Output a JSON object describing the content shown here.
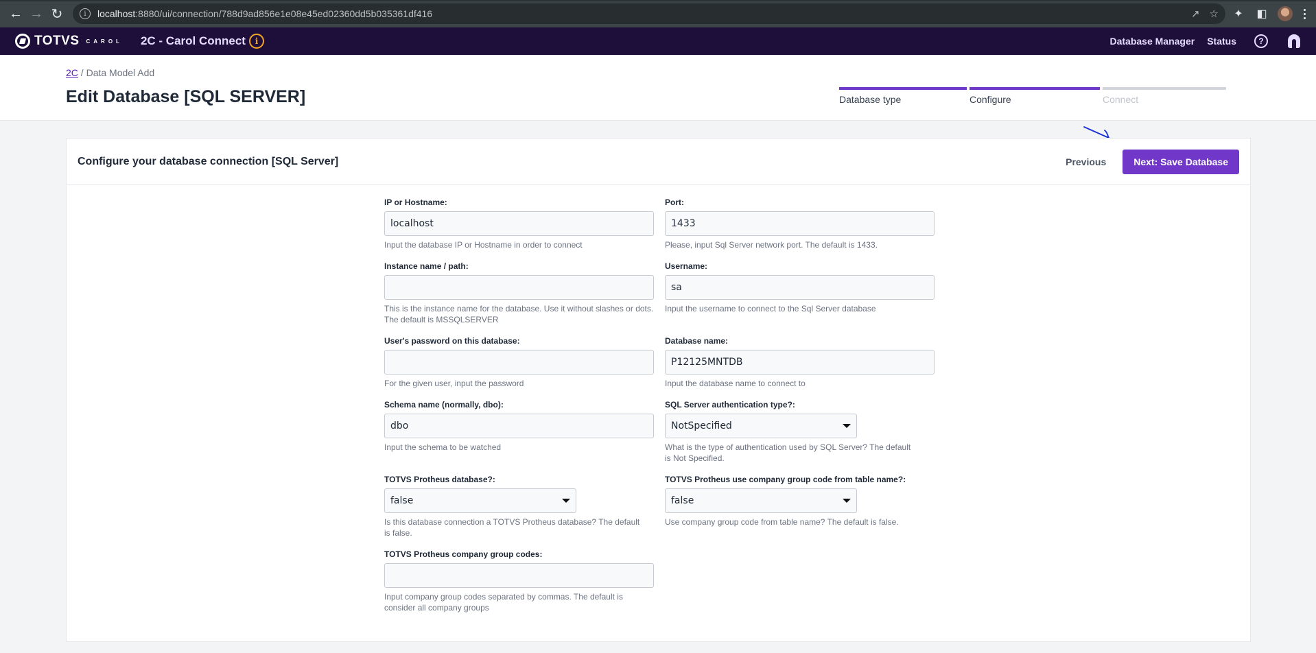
{
  "browser": {
    "url_host": "localhost",
    "url_rest": ":8880/ui/connection/788d9ad856e1e08e45ed02360dd5b035361df416"
  },
  "app": {
    "logo_text": "TOTVS",
    "logo_sub": "CAROL",
    "title": "2C - Carol Connect",
    "info_glyph": "i",
    "nav": [
      {
        "label": "Database Manager"
      },
      {
        "label": "Status"
      }
    ],
    "help_glyph": "?"
  },
  "page": {
    "breadcrumb_link": "2C",
    "breadcrumb_sep": " / ",
    "breadcrumb_current": "Data Model Add",
    "title": "Edit Database [SQL SERVER]",
    "steps": [
      {
        "label": "Database type",
        "state": "done"
      },
      {
        "label": "Configure",
        "state": "done"
      },
      {
        "label": "Connect",
        "state": "pending"
      }
    ]
  },
  "card": {
    "title": "Configure your database connection [SQL Server]",
    "previous_label": "Previous",
    "next_label": "Next: Save Database"
  },
  "form": {
    "host": {
      "label": "IP or Hostname:",
      "value": "localhost",
      "help": "Input the database IP or Hostname in order to connect"
    },
    "port": {
      "label": "Port:",
      "value": "1433",
      "help": "Please, input Sql Server network port. The default is 1433."
    },
    "instance": {
      "label": "Instance name / path:",
      "value": "",
      "help": "This is the instance name for the database. Use it without slashes or dots. The default is MSSQLSERVER"
    },
    "username": {
      "label": "Username:",
      "value": "sa",
      "help": "Input the username to connect to the Sql Server database"
    },
    "password": {
      "label": "User's password on this database:",
      "value": "",
      "help": "For the given user, input the password"
    },
    "dbname": {
      "label": "Database name:",
      "value": "P12125MNTDB",
      "help": "Input the database name to connect to"
    },
    "schema": {
      "label": "Schema name (normally, dbo):",
      "value": "dbo",
      "help": "Input the schema to be watched"
    },
    "auth": {
      "label": "SQL Server authentication type?:",
      "value": "NotSpecified",
      "help": "What is the type of authentication used by SQL Server? The default is Not Specified."
    },
    "protheus": {
      "label": "TOTVS Protheus database?:",
      "value": "false",
      "help": "Is this database connection a TOTVS Protheus database? The default is false."
    },
    "group_from_table": {
      "label": "TOTVS Protheus use company group code from table name?:",
      "value": "false",
      "help": "Use company group code from table name? The default is false."
    },
    "group_codes": {
      "label": "TOTVS Protheus company group codes:",
      "value": "",
      "help": "Input company group codes separated by commas. The default is consider all company groups"
    }
  },
  "colors": {
    "brand": "#7037c8",
    "header_bg": "#1e0e3a",
    "info_accent": "#f5a524"
  }
}
